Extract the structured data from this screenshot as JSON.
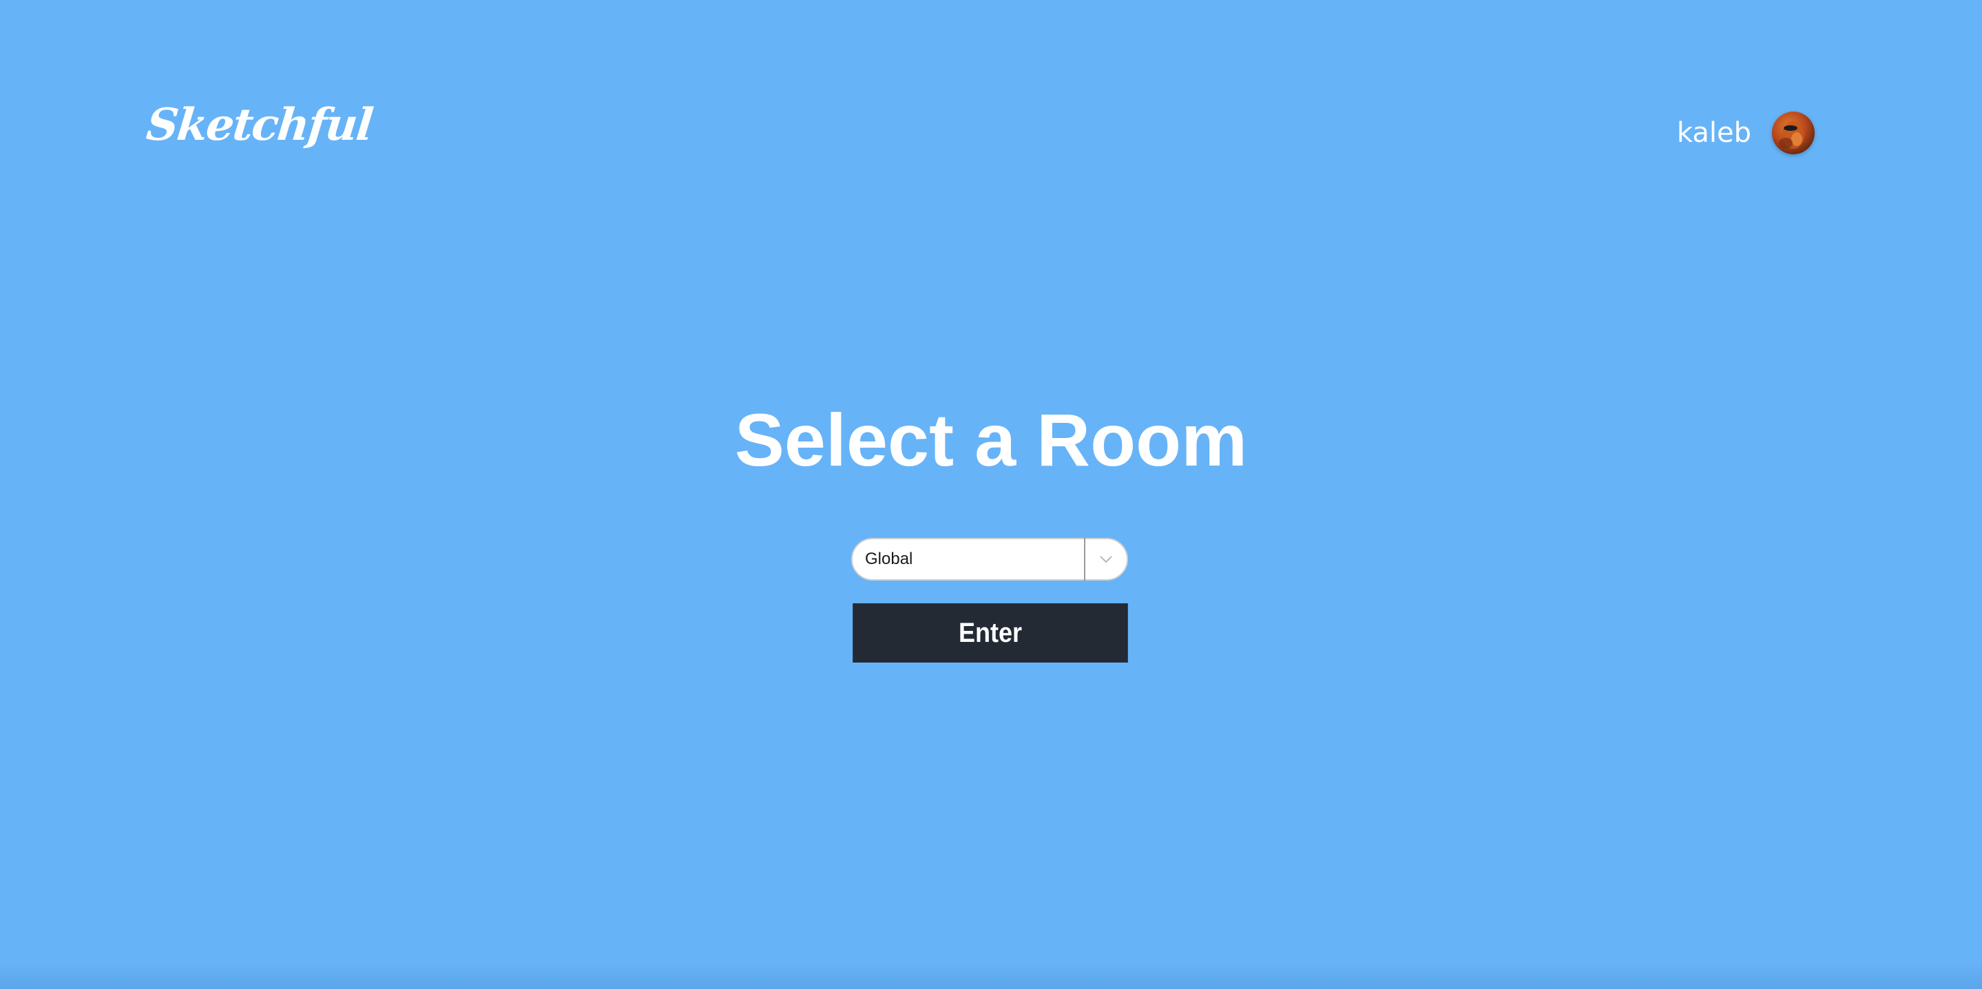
{
  "app": {
    "logo_text": "Sketchful"
  },
  "header": {
    "username": "kaleb",
    "avatar_icon": "user-avatar-icon"
  },
  "main": {
    "title": "Select a Room",
    "room_select": {
      "selected_value": "Global",
      "arrow_icon": "chevron-down-icon"
    },
    "enter_label": "Enter"
  },
  "colors": {
    "background": "#67b3f7",
    "button": "#232a34",
    "text": "#ffffff"
  }
}
